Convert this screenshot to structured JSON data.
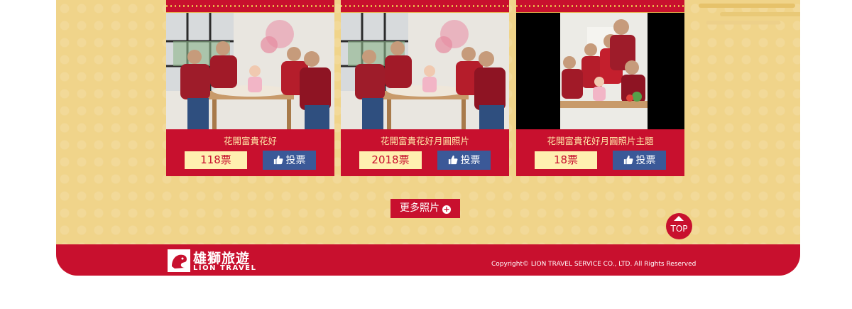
{
  "colors": {
    "accent_red": "#c8102e",
    "panel_gold": "#f0d48a",
    "vote_blue": "#3b5998",
    "count_bg": "#fff0b0"
  },
  "cards": [
    {
      "title": "花開富貴花好",
      "votes": "118票",
      "vote_label": "投票",
      "photo": "family-dinner-photo"
    },
    {
      "title": "花開富貴花好月圓照片",
      "votes": "2018票",
      "vote_label": "投票",
      "photo": "family-dinner-photo"
    },
    {
      "title": "花開富貴花好月圓照片主題",
      "votes": "18票",
      "vote_label": "投票",
      "photo": "family-portrait-photo"
    }
  ],
  "more_button": {
    "label": "更多照片",
    "icon": "plus-circle-icon"
  },
  "top_button": {
    "label": "TOP"
  },
  "footer": {
    "logo_cn": "雄獅旅遊",
    "logo_en": "LION TRAVEL",
    "copyright": "Copyright© LION TRAVEL SERVICE CO., LTD. All Rights Reserved"
  }
}
